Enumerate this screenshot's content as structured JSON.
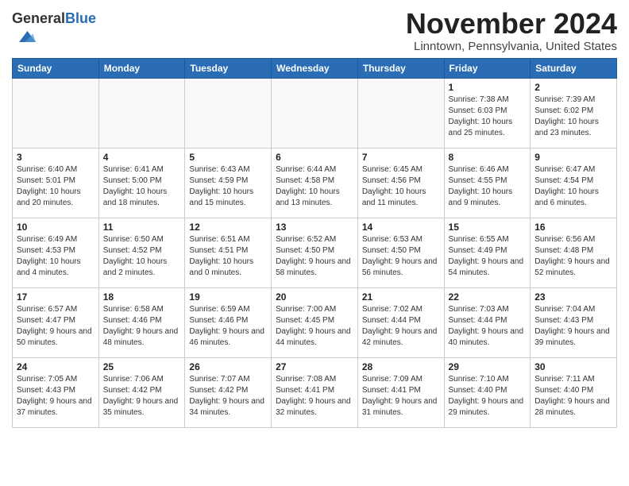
{
  "header": {
    "logo_general": "General",
    "logo_blue": "Blue",
    "month": "November 2024",
    "location": "Linntown, Pennsylvania, United States"
  },
  "weekdays": [
    "Sunday",
    "Monday",
    "Tuesday",
    "Wednesday",
    "Thursday",
    "Friday",
    "Saturday"
  ],
  "weeks": [
    [
      {
        "day": "",
        "info": ""
      },
      {
        "day": "",
        "info": ""
      },
      {
        "day": "",
        "info": ""
      },
      {
        "day": "",
        "info": ""
      },
      {
        "day": "",
        "info": ""
      },
      {
        "day": "1",
        "info": "Sunrise: 7:38 AM\nSunset: 6:03 PM\nDaylight: 10 hours and 25 minutes."
      },
      {
        "day": "2",
        "info": "Sunrise: 7:39 AM\nSunset: 6:02 PM\nDaylight: 10 hours and 23 minutes."
      }
    ],
    [
      {
        "day": "3",
        "info": "Sunrise: 6:40 AM\nSunset: 5:01 PM\nDaylight: 10 hours and 20 minutes."
      },
      {
        "day": "4",
        "info": "Sunrise: 6:41 AM\nSunset: 5:00 PM\nDaylight: 10 hours and 18 minutes."
      },
      {
        "day": "5",
        "info": "Sunrise: 6:43 AM\nSunset: 4:59 PM\nDaylight: 10 hours and 15 minutes."
      },
      {
        "day": "6",
        "info": "Sunrise: 6:44 AM\nSunset: 4:58 PM\nDaylight: 10 hours and 13 minutes."
      },
      {
        "day": "7",
        "info": "Sunrise: 6:45 AM\nSunset: 4:56 PM\nDaylight: 10 hours and 11 minutes."
      },
      {
        "day": "8",
        "info": "Sunrise: 6:46 AM\nSunset: 4:55 PM\nDaylight: 10 hours and 9 minutes."
      },
      {
        "day": "9",
        "info": "Sunrise: 6:47 AM\nSunset: 4:54 PM\nDaylight: 10 hours and 6 minutes."
      }
    ],
    [
      {
        "day": "10",
        "info": "Sunrise: 6:49 AM\nSunset: 4:53 PM\nDaylight: 10 hours and 4 minutes."
      },
      {
        "day": "11",
        "info": "Sunrise: 6:50 AM\nSunset: 4:52 PM\nDaylight: 10 hours and 2 minutes."
      },
      {
        "day": "12",
        "info": "Sunrise: 6:51 AM\nSunset: 4:51 PM\nDaylight: 10 hours and 0 minutes."
      },
      {
        "day": "13",
        "info": "Sunrise: 6:52 AM\nSunset: 4:50 PM\nDaylight: 9 hours and 58 minutes."
      },
      {
        "day": "14",
        "info": "Sunrise: 6:53 AM\nSunset: 4:50 PM\nDaylight: 9 hours and 56 minutes."
      },
      {
        "day": "15",
        "info": "Sunrise: 6:55 AM\nSunset: 4:49 PM\nDaylight: 9 hours and 54 minutes."
      },
      {
        "day": "16",
        "info": "Sunrise: 6:56 AM\nSunset: 4:48 PM\nDaylight: 9 hours and 52 minutes."
      }
    ],
    [
      {
        "day": "17",
        "info": "Sunrise: 6:57 AM\nSunset: 4:47 PM\nDaylight: 9 hours and 50 minutes."
      },
      {
        "day": "18",
        "info": "Sunrise: 6:58 AM\nSunset: 4:46 PM\nDaylight: 9 hours and 48 minutes."
      },
      {
        "day": "19",
        "info": "Sunrise: 6:59 AM\nSunset: 4:46 PM\nDaylight: 9 hours and 46 minutes."
      },
      {
        "day": "20",
        "info": "Sunrise: 7:00 AM\nSunset: 4:45 PM\nDaylight: 9 hours and 44 minutes."
      },
      {
        "day": "21",
        "info": "Sunrise: 7:02 AM\nSunset: 4:44 PM\nDaylight: 9 hours and 42 minutes."
      },
      {
        "day": "22",
        "info": "Sunrise: 7:03 AM\nSunset: 4:44 PM\nDaylight: 9 hours and 40 minutes."
      },
      {
        "day": "23",
        "info": "Sunrise: 7:04 AM\nSunset: 4:43 PM\nDaylight: 9 hours and 39 minutes."
      }
    ],
    [
      {
        "day": "24",
        "info": "Sunrise: 7:05 AM\nSunset: 4:43 PM\nDaylight: 9 hours and 37 minutes."
      },
      {
        "day": "25",
        "info": "Sunrise: 7:06 AM\nSunset: 4:42 PM\nDaylight: 9 hours and 35 minutes."
      },
      {
        "day": "26",
        "info": "Sunrise: 7:07 AM\nSunset: 4:42 PM\nDaylight: 9 hours and 34 minutes."
      },
      {
        "day": "27",
        "info": "Sunrise: 7:08 AM\nSunset: 4:41 PM\nDaylight: 9 hours and 32 minutes."
      },
      {
        "day": "28",
        "info": "Sunrise: 7:09 AM\nSunset: 4:41 PM\nDaylight: 9 hours and 31 minutes."
      },
      {
        "day": "29",
        "info": "Sunrise: 7:10 AM\nSunset: 4:40 PM\nDaylight: 9 hours and 29 minutes."
      },
      {
        "day": "30",
        "info": "Sunrise: 7:11 AM\nSunset: 4:40 PM\nDaylight: 9 hours and 28 minutes."
      }
    ]
  ]
}
